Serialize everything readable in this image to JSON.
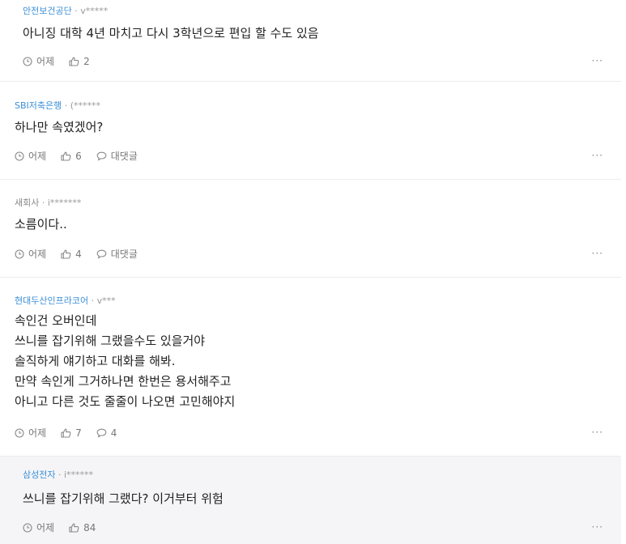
{
  "comments": [
    {
      "company": "안전보건공단",
      "user": "v*****",
      "text": "아니징 대학 4년 마치고 다시 3학년으로 편입 할 수도 있음",
      "time": "어제",
      "likes": "2",
      "reply_label": "",
      "reply_count": ""
    },
    {
      "company": "SBI저축은행",
      "user": "(******",
      "text": "하나만 속였겠어?",
      "time": "어제",
      "likes": "6",
      "reply_label": "대댓글",
      "reply_count": ""
    },
    {
      "company": "새회사",
      "user": "i*******",
      "text": "소름이다..",
      "time": "어제",
      "likes": "4",
      "reply_label": "대댓글",
      "reply_count": ""
    },
    {
      "company": "현대두산인프라코어",
      "user": "v***",
      "text": "속인건 오버인데\n쓰니를 잡기위해 그랬을수도 있을거야\n솔직하게 얘기하고 대화를 해봐.\n만약 속인게 그거하나면 한번은 용서해주고\n아니고 다른 것도 줄줄이 나오면 고민해야지",
      "time": "어제",
      "likes": "7",
      "reply_label": "",
      "reply_count": "4"
    },
    {
      "company": "삼성전자",
      "user": "i******",
      "text": "쓰니를 잡기위해 그랬다? 이거부터 위험",
      "time": "어제",
      "likes": "84",
      "reply_label": "",
      "reply_count": ""
    }
  ],
  "separator": "·",
  "more_label": "···",
  "icons": {
    "time": "clock-icon",
    "like": "thumbs-up-icon",
    "reply": "speech-bubble-icon",
    "more": "more-dots-icon"
  },
  "colors": {
    "company_link": "#3c8fd6",
    "meta_text": "#777777",
    "reply_bg": "#f5f5f7"
  }
}
